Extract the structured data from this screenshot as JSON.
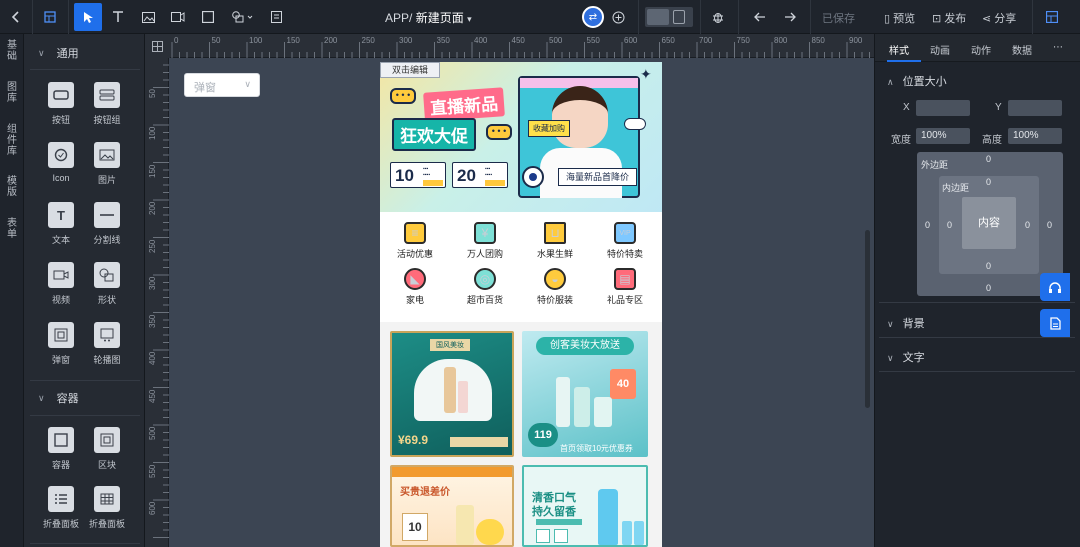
{
  "topbar": {
    "title_prefix": "APP/",
    "title_name": "新建页面",
    "saved": "已保存",
    "preview": "预览",
    "publish": "发布",
    "share": "分享"
  },
  "left_rail": [
    "基础",
    "图库",
    "组件库",
    "模版",
    "表单"
  ],
  "left_panel": {
    "section_general": "通用",
    "general_items": [
      "按钮",
      "按钮组",
      "Icon",
      "图片",
      "文本",
      "分割线",
      "视频",
      "形状",
      "弹窗",
      "轮播图"
    ],
    "section_container": "容器",
    "container_items": [
      "容器",
      "区块",
      "折叠面板",
      "折叠面板"
    ]
  },
  "ruler": {
    "top_ticks": [
      "0",
      "50",
      "100",
      "150",
      "200",
      "250",
      "300",
      "350",
      "400",
      "450",
      "500",
      "550",
      "600",
      "650",
      "700",
      "750",
      "800",
      "850",
      "900"
    ],
    "left_ticks": [
      "50",
      "100",
      "150",
      "200",
      "250",
      "300",
      "350",
      "400",
      "450",
      "500",
      "550",
      "600",
      "650"
    ]
  },
  "canvas": {
    "popup_select": "弹窗",
    "double_click_edit": "双击编辑"
  },
  "banner": {
    "title1": "直播新品",
    "title2": "狂欢大促",
    "tag": "收藏加购",
    "strip": "海量新品首降价",
    "coupon1_num": "10",
    "coupon2_num": "20"
  },
  "quick_icons": [
    "活动优惠",
    "万人团购",
    "水果生鲜",
    "特价特卖",
    "家电",
    "超市百货",
    "特价服装",
    "礼品专区"
  ],
  "products": {
    "p1_tag": "国风美妆",
    "p1_price": "¥69.9",
    "p2_title": "创客美妆大放送",
    "p2_badge": "40",
    "p2_price": "119",
    "p2_footer": "首页领取10元优惠券",
    "p3_title": "买贵退差价",
    "p3_badge": "10",
    "p4_title": "清香口气",
    "p4_sub": "持久留香"
  },
  "right_panel": {
    "tabs": [
      "样式",
      "动画",
      "动作",
      "数据"
    ],
    "section_position": "位置大小",
    "label_x": "X",
    "label_y": "Y",
    "label_width": "宽度",
    "value_width": "100%",
    "label_height": "高度",
    "value_height": "100%",
    "margin_label": "外边距",
    "padding_label": "内边距",
    "content_label": "内容",
    "box_zero": "0",
    "section_background": "背景",
    "section_text": "文字"
  },
  "colors": {
    "accent": "#1f6feb",
    "panel": "#1f242c",
    "canvas": "#3c4553"
  }
}
